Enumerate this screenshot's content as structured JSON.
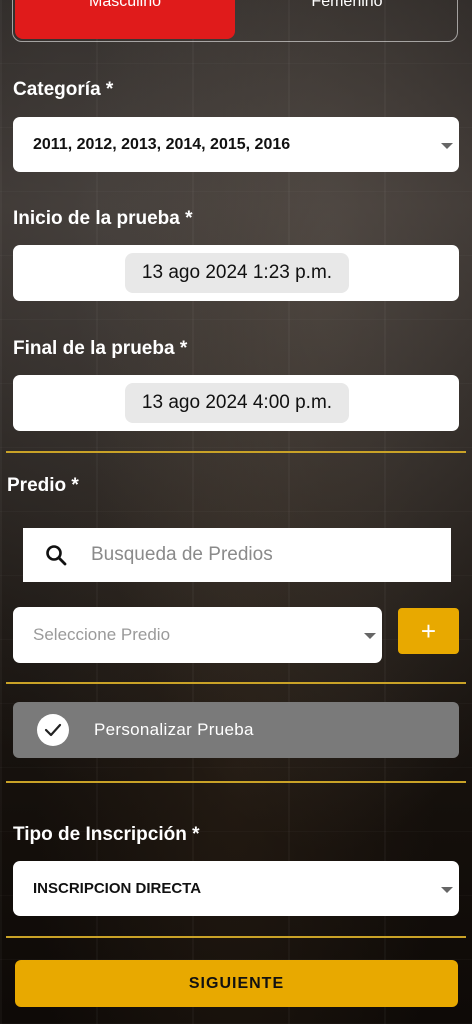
{
  "gender": {
    "male_label": "Masculino",
    "female_label": "Femenino",
    "selected": "Masculino"
  },
  "category": {
    "label": "Categoría *",
    "value": "2011, 2012, 2013, 2014, 2015, 2016"
  },
  "start": {
    "label": "Inicio de la prueba *",
    "value": "13 ago 2024 1:23 p.m."
  },
  "end": {
    "label": "Final de la prueba *",
    "value": "13 ago 2024 4:00 p.m."
  },
  "predio": {
    "label": "Predio *",
    "search_placeholder": "Busqueda de Predios",
    "select_placeholder": "Seleccione Predio",
    "add_label": "+"
  },
  "custom": {
    "label": "Personalizar Prueba",
    "checked": true
  },
  "inscription": {
    "label": "Tipo de Inscripción *",
    "value": "INSCRIPCION DIRECTA"
  },
  "next_label": "SIGUIENTE",
  "colors": {
    "accent": "#e8a900",
    "selected_gender": "#e01b1b",
    "divider": "#c9a227",
    "custom_row": "#7a7a7a"
  }
}
